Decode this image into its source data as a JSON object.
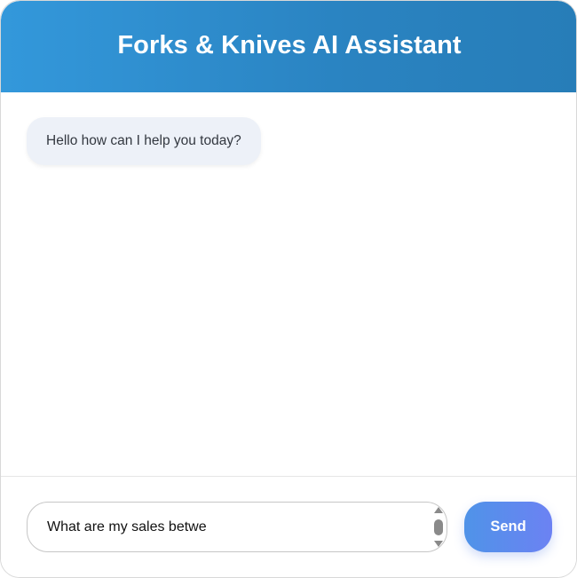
{
  "header": {
    "title": "Forks & Knives AI Assistant"
  },
  "messages": [
    {
      "sender": "assistant",
      "text": "Hello how can I help you today?"
    }
  ],
  "composer": {
    "value": "What are my sales betwe",
    "send_label": "Send"
  },
  "colors": {
    "header_gradient_start": "#3398db",
    "header_gradient_end": "#277db8",
    "bubble_background": "#edf1f8",
    "send_gradient_start": "#4f93e8",
    "send_gradient_end": "#6c82f3"
  }
}
